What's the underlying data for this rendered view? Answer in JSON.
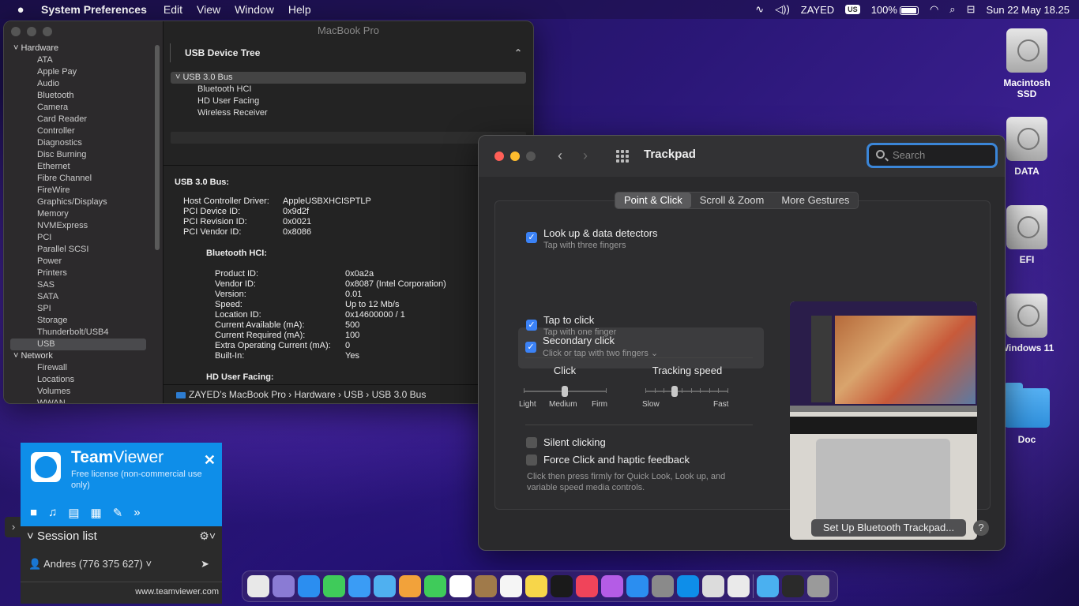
{
  "menubar": {
    "app": "System Preferences",
    "items": [
      "Edit",
      "View",
      "Window",
      "Help"
    ],
    "user": "ZAYED",
    "lang": "US",
    "battery": "100%",
    "datetime": "Sun 22 May  18.25"
  },
  "sysinfo": {
    "title": "MacBook Pro",
    "sidebar": [
      {
        "t": "sec",
        "label": "Hardware"
      },
      {
        "t": "itm",
        "label": "ATA"
      },
      {
        "t": "itm",
        "label": "Apple Pay"
      },
      {
        "t": "itm",
        "label": "Audio"
      },
      {
        "t": "itm",
        "label": "Bluetooth"
      },
      {
        "t": "itm",
        "label": "Camera"
      },
      {
        "t": "itm",
        "label": "Card Reader"
      },
      {
        "t": "itm",
        "label": "Controller"
      },
      {
        "t": "itm",
        "label": "Diagnostics"
      },
      {
        "t": "itm",
        "label": "Disc Burning"
      },
      {
        "t": "itm",
        "label": "Ethernet"
      },
      {
        "t": "itm",
        "label": "Fibre Channel"
      },
      {
        "t": "itm",
        "label": "FireWire"
      },
      {
        "t": "itm",
        "label": "Graphics/Displays"
      },
      {
        "t": "itm",
        "label": "Memory"
      },
      {
        "t": "itm",
        "label": "NVMExpress"
      },
      {
        "t": "itm",
        "label": "PCI"
      },
      {
        "t": "itm",
        "label": "Parallel SCSI"
      },
      {
        "t": "itm",
        "label": "Power"
      },
      {
        "t": "itm",
        "label": "Printers"
      },
      {
        "t": "itm",
        "label": "SAS"
      },
      {
        "t": "itm",
        "label": "SATA"
      },
      {
        "t": "itm",
        "label": "SPI"
      },
      {
        "t": "itm",
        "label": "Storage"
      },
      {
        "t": "itm",
        "label": "Thunderbolt/USB4"
      },
      {
        "t": "sel",
        "label": "USB"
      },
      {
        "t": "sec",
        "label": "Network"
      },
      {
        "t": "itm",
        "label": "Firewall"
      },
      {
        "t": "itm",
        "label": "Locations"
      },
      {
        "t": "itm",
        "label": "Volumes"
      },
      {
        "t": "itm",
        "label": "WWAN"
      }
    ],
    "tree_header": "USB Device Tree",
    "bus": "USB 3.0 Bus",
    "devices": [
      "Bluetooth HCI",
      "HD User Facing",
      "Wireless Receiver"
    ],
    "detail_title": "USB 3.0 Bus:",
    "bus_props": [
      [
        "Host Controller Driver:",
        "AppleUSBXHCISPTLP"
      ],
      [
        "PCI Device ID:",
        "0x9d2f"
      ],
      [
        "PCI Revision ID:",
        "0x0021"
      ],
      [
        "PCI Vendor ID:",
        "0x8086"
      ]
    ],
    "sub_title": "Bluetooth HCI:",
    "hci_props": [
      [
        "Product ID:",
        "0x0a2a"
      ],
      [
        "Vendor ID:",
        "0x8087  (Intel Corporation)"
      ],
      [
        "Version:",
        "0.01"
      ],
      [
        "Speed:",
        "Up to 12 Mb/s"
      ],
      [
        "Location ID:",
        "0x14600000 / 1"
      ],
      [
        "Current Available (mA):",
        "500"
      ],
      [
        "Current Required (mA):",
        "100"
      ],
      [
        "Extra Operating Current (mA):",
        "0"
      ],
      [
        "Built-In:",
        "Yes"
      ]
    ],
    "next_title": "HD User Facing:",
    "path": "ZAYED’s MacBook Pro › Hardware › USB › USB 3.0 Bus"
  },
  "trackpad": {
    "title": "Trackpad",
    "search_placeholder": "Search",
    "tabs": [
      "Point & Click",
      "Scroll & Zoom",
      "More Gestures"
    ],
    "opt1": {
      "title": "Look up & data detectors",
      "sub": "Tap with three fingers"
    },
    "opt2": {
      "title": "Secondary click",
      "sub": "Click or tap with two fingers ⌄"
    },
    "opt3": {
      "title": "Tap to click",
      "sub": "Tap with one finger"
    },
    "click": {
      "title": "Click",
      "labels": [
        "Light",
        "Medium",
        "Firm"
      ],
      "level": 0.5
    },
    "speed": {
      "title": "Tracking speed",
      "labels": [
        "Slow",
        "Fast"
      ],
      "level": 0.36
    },
    "silent": "Silent clicking",
    "force": "Force Click and haptic feedback",
    "force_desc": "Click then press firmly for Quick Look, Look up, and variable speed media controls.",
    "setup_btn": "Set Up Bluetooth Trackpad...",
    "help": "?"
  },
  "desktop": [
    "Macintosh SSD",
    "DATA",
    "EFI",
    "Windows 11",
    "Doc"
  ],
  "teamviewer": {
    "brand_a": "Team",
    "brand_b": "Viewer",
    "sub": "Free license (non-commercial use only)",
    "session": "Session list",
    "user": "Andres (776 375 627) ˅",
    "url": "www.teamviewer.com"
  },
  "dock_colors": [
    "#e8e8e8",
    "#8a7bd4",
    "#2b8ef0",
    "#3fcb5a",
    "#3a9cf5",
    "#4fb0f0",
    "#f2a23a",
    "#3fcb5a",
    "#ffffff",
    "#a07a4a",
    "#f5f5f5",
    "#f7d64a",
    "#1a1a1a",
    "#f0445a",
    "#b45ce6",
    "#2b8ef0",
    "#8a8a8a",
    "#0e8ee9",
    "#dcdcdc",
    "#eaeaea",
    "#4ab0f0",
    "#2a2a2a",
    "#9a9a9a"
  ]
}
